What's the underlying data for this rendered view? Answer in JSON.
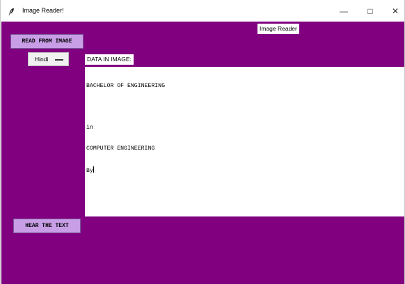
{
  "window": {
    "title": "Image Reader!"
  },
  "header": {
    "top_label": "Image   Reader"
  },
  "controls": {
    "read_button": "READ FROM IMAGE",
    "language_select": "Hindi",
    "hear_button": "HEAR THE TEXT"
  },
  "content": {
    "data_label": "DATA IN IMAGE:",
    "text_lines": [
      "BACHELOR OF ENGINEERING",
      "",
      "in",
      "COMPUTER ENGINEERING",
      "By"
    ]
  },
  "icons": {
    "app": "feather-icon",
    "minimize": "minimize-icon",
    "maximize": "maximize-icon",
    "close": "close-icon"
  },
  "colors": {
    "background": "#800080",
    "button": "#c89ee6",
    "text_area": "#ffffff",
    "label_background": "#ffffff"
  }
}
